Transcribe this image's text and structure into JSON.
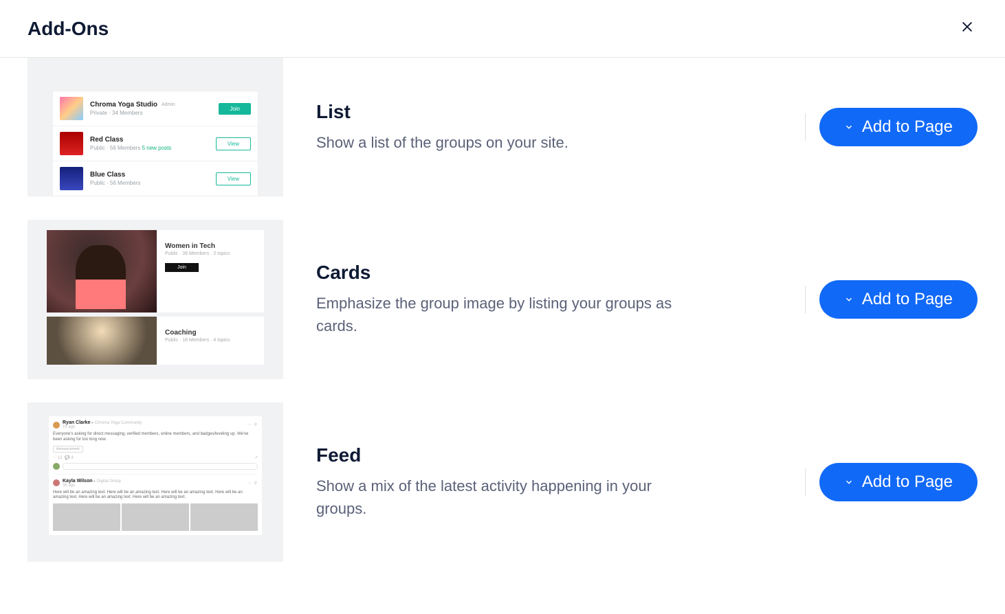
{
  "header": {
    "title": "Add-Ons"
  },
  "action_label": "Add to Page",
  "addons": [
    {
      "title": "List",
      "desc": "Show a list of the groups on your site.",
      "preview_list": [
        {
          "title": "Chroma Yoga Studio",
          "badge": "Admin",
          "sub": "Private · 34 Members",
          "cta": "Join",
          "cta_style": "join"
        },
        {
          "title": "Red Class",
          "sub": "Public · 56 Members",
          "sub_extra": "5 new posts",
          "cta": "View",
          "cta_style": "view"
        },
        {
          "title": "Blue Class",
          "sub": "Public · 56 Members",
          "cta": "View",
          "cta_style": "view"
        }
      ]
    },
    {
      "title": "Cards",
      "desc": "Emphasize the group image by listing your groups as cards.",
      "preview_cards": [
        {
          "title": "Women in Tech",
          "sub": "Public · 39 Members · 2 topics",
          "btn": "Join"
        },
        {
          "title": "Coaching",
          "sub": "Public · 18 Members · 4 topics"
        }
      ]
    },
    {
      "title": "Feed",
      "desc": "Show a mix of the latest activity happening in your groups.",
      "preview_feed": {
        "post1": {
          "author": "Ryan Clarke",
          "group": "Chroma Yoga Community",
          "time": "1h ago",
          "body": "Everyone's asking for direct messaging, verified members, online members, and badges/leveling up. We've been asking for too long now.",
          "tag": "Announcement",
          "likes": "12",
          "comments": "4"
        },
        "post2": {
          "author": "Kayla Wilson",
          "group": "Digital Group",
          "time": "3h ago",
          "body": "Here will be an amazing text. Here will be an amazing text. Here will be an amazing text. Here will be an amazing text. Here will be an amazing text. Here will be an amazing text."
        }
      }
    }
  ]
}
